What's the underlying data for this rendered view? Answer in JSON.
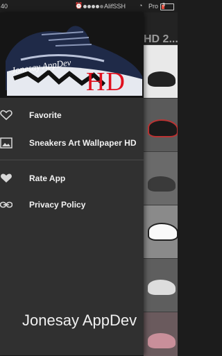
{
  "status_bar": {
    "time": "40",
    "carrier": "AlifSSH",
    "network": "Pro",
    "battery": "3"
  },
  "background_app": {
    "title": "HD 2..."
  },
  "drawer": {
    "header_image": {
      "logo_text": "Jonesay AppDev",
      "badge": "HD"
    },
    "items": [
      {
        "label": "Favorite",
        "icon": "heart-outline-icon"
      },
      {
        "label": "Sneakers Art Wallpaper HD",
        "icon": "image-icon"
      },
      {
        "label": "Rate App",
        "icon": "heart-icon"
      },
      {
        "label": "Privacy Policy",
        "icon": "link-icon"
      }
    ],
    "footer_brand": "Jonesay AppDev"
  },
  "colors": {
    "drawer_bg": "#303030",
    "accent_red": "#e0101e"
  }
}
